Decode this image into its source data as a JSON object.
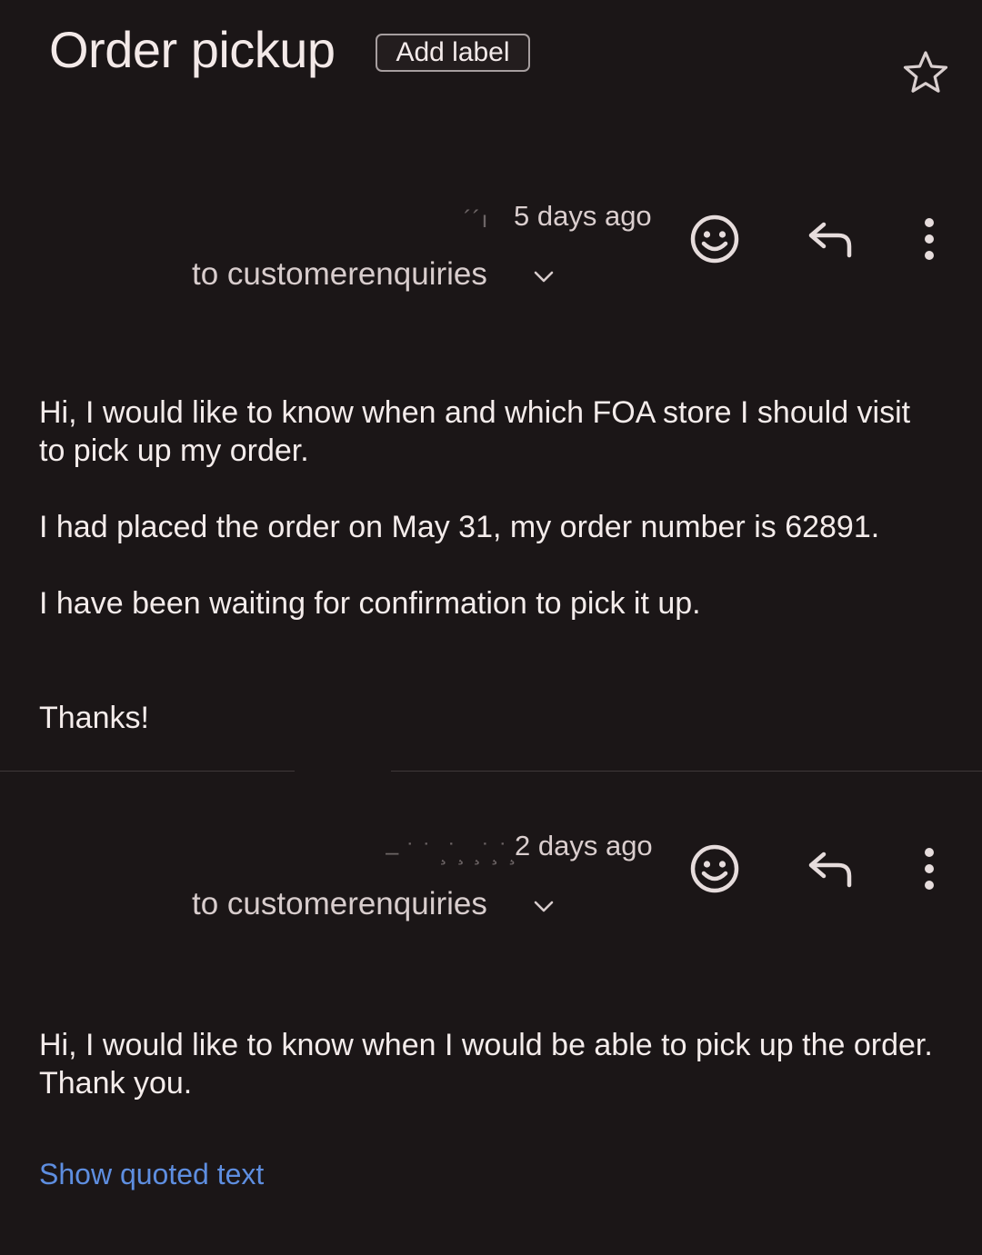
{
  "header": {
    "subject": "Order pickup",
    "add_label": "Add label",
    "star_icon": "star-outline-icon"
  },
  "messages": [
    {
      "sender": "´´ı",
      "time": "5 days ago",
      "recipient": "to customerenquiries",
      "body": [
        "Hi, I would like to know when and which FOA store I should visit to pick up my order.",
        "I had placed the order on May 31, my order number is 62891.",
        "I have been waiting for confirmation to pick it up.",
        "Thanks!"
      ]
    },
    {
      "sender": "– ˙ ˙ ¸˙¸ ¸˙¸˙¸",
      "time": "2 days ago",
      "recipient": "to customerenquiries",
      "body": [
        "Hi, I would like to know when I would be able to pick up the order. Thank you."
      ],
      "show_quoted": "Show quoted text"
    }
  ],
  "colors": {
    "background": "#1b1617",
    "text": "#f4eceb",
    "link": "#5e8ee0",
    "divider": "#3f3939"
  }
}
